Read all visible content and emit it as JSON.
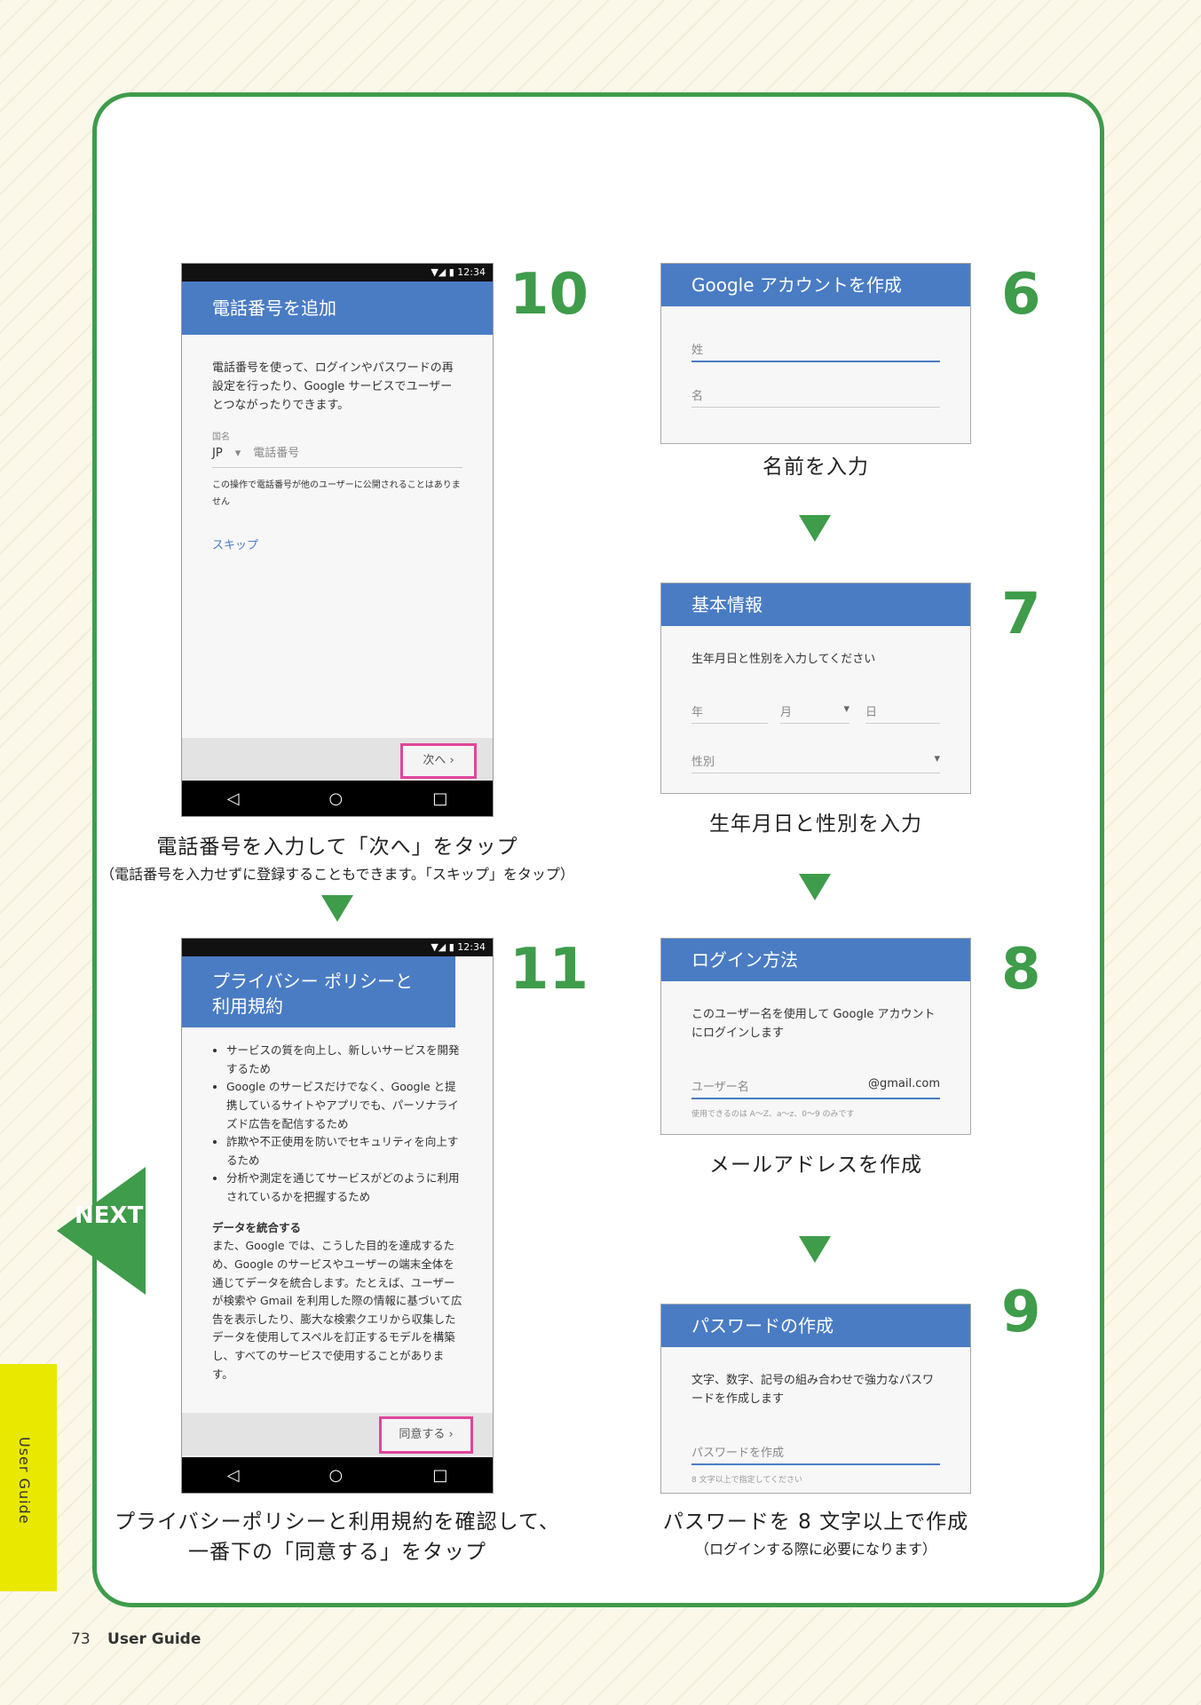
{
  "step10": {
    "number": "10",
    "status_time": "12:34",
    "title": "電話番号を追加",
    "body": "電話番号を使って、ログインやパスワードの再設定を行ったり、Google サービスでユーザーとつながったりできます。",
    "country_label": "国名",
    "country_value": "JP",
    "phone_placeholder": "電話番号",
    "note": "この操作で電話番号が他のユーザーに公開されることはありません",
    "skip": "スキップ",
    "next_button": "次へ",
    "caption": "電話番号を入力して「次へ」をタップ",
    "caption_sub": "（電話番号を入力せずに登録することもできます。「スキップ」をタップ）"
  },
  "step11": {
    "number": "11",
    "status_time": "12:34",
    "title": "プライバシー ポリシーと利用規約",
    "bullets": [
      "サービスの質を向上し、新しいサービスを開発するため",
      "Google のサービスだけでなく、Google と提携しているサイトやアプリでも、パーソナライズド広告を配信するため",
      "詐欺や不正使用を防いでセキュリティを向上するため",
      "分析や測定を通じてサービスがどのように利用されているかを把握するため"
    ],
    "section_title": "データを統合する",
    "section_body": "また、Google では、こうした目的を達成するため、Google のサービスやユーザーの端末全体を通じてデータを統合します。たとえば、ユーザーが検索や Gmail を利用した際の情報に基づいて広告を表示したり、膨大な検索クエリから収集したデータを使用してスペルを訂正するモデルを構築し、すべてのサービスで使用することがあります。",
    "agree_button": "同意する",
    "caption": "プライバシーポリシーと利用規約を確認して、",
    "caption2": "一番下の「同意する」をタップ"
  },
  "step6": {
    "number": "6",
    "title": "Google アカウントを作成",
    "last_name": "姓",
    "first_name": "名",
    "caption": "名前を入力"
  },
  "step7": {
    "number": "7",
    "title": "基本情報",
    "prompt": "生年月日と性別を入力してください",
    "year": "年",
    "month": "月",
    "day": "日",
    "gender": "性別",
    "caption": "生年月日と性別を入力"
  },
  "step8": {
    "number": "8",
    "title": "ログイン方法",
    "body": "このユーザー名を使用して Google アカウントにログインします",
    "username": "ユーザー名",
    "domain": "@gmail.com",
    "hint": "使用できるのは A〜Z、a〜z、0〜9 のみです",
    "caption": "メールアドレスを作成"
  },
  "step9": {
    "number": "9",
    "title": "パスワードの作成",
    "body": "文字、数字、記号の組み合わせで強力なパスワードを作成します",
    "password": "パスワードを作成",
    "hint": "8 文字以上で指定してください",
    "caption": "パスワードを 8 文字以上で作成",
    "caption_sub": "（ログインする際に必要になります）"
  },
  "next_label": "NEXT",
  "side_tab": "User Guide",
  "footer": {
    "page": "73",
    "label": "User Guide"
  },
  "colors": {
    "green": "#3f9c4a",
    "blue": "#4a7cc4",
    "pink": "#e0469b",
    "yellow": "#e8e800"
  }
}
